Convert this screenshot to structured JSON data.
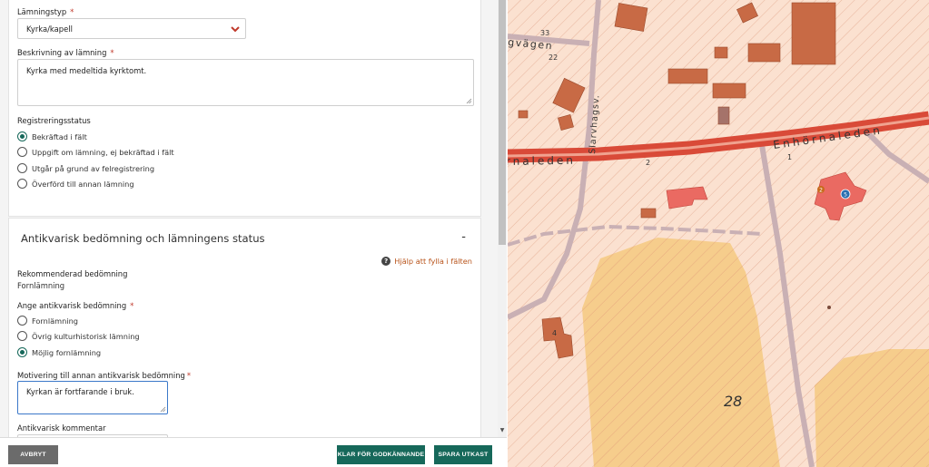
{
  "form": {
    "lamningstyp": {
      "label": "Lämningstyp",
      "required_mark": "*",
      "value": "Kyrka/kapell"
    },
    "beskrivning": {
      "label": "Beskrivning av lämning",
      "required_mark": "*",
      "value": "Kyrka med medeltida kyrktomt."
    },
    "registreringsstatus": {
      "label": "Registreringsstatus",
      "options": [
        {
          "label": "Bekräftad i fält",
          "selected": true
        },
        {
          "label": "Uppgift om lämning, ej bekräftad i fält",
          "selected": false
        },
        {
          "label": "Utgår på grund av felregistrering",
          "selected": false
        },
        {
          "label": "Överförd till annan lämning",
          "selected": false
        }
      ]
    },
    "antikvarisk": {
      "title": "Antikvarisk bedömning och lämningens status",
      "collapse_symbol": "-",
      "help_link": "Hjälp att fylla i fälten",
      "rekommenderad_label": "Rekommenderad bedömning",
      "rekommenderad_value": "Fornlämning",
      "ange_label": "Ange antikvarisk bedömning",
      "ange_required_mark": "*",
      "options": [
        {
          "label": "Fornlämning",
          "selected": false
        },
        {
          "label": "Övrig kulturhistorisk lämning",
          "selected": false
        },
        {
          "label": "Möjlig fornlämning",
          "selected": true
        }
      ],
      "motivering_label": "Motivering till annan antikvarisk bedömning",
      "motivering_required_mark": "*",
      "motivering_value": "Kyrkan är fortfarande i bruk.",
      "kommentar_label": "Antikvarisk kommentar"
    }
  },
  "buttons": {
    "cancel": "AVBRYT",
    "ready": "KLAR FÖR GODKÄNNANDE",
    "save": "SPARA UTKAST"
  },
  "map": {
    "labels": {
      "road_main_right": "Enhörnaleden",
      "road_main_left": "rnaleden",
      "road_vertical": "Slarvhagsv.",
      "road_top_left": "gvägen",
      "num_33": "33",
      "num_22": "22",
      "num_2": "2",
      "num_1": "1",
      "num_4": "4",
      "num_28": "28",
      "marker_1": "1",
      "marker_2": "2",
      "marker_5": "5"
    }
  },
  "colors": {
    "accent": "#16685a",
    "link": "#b8531a",
    "required": "#c0392b",
    "road": "#d94a38",
    "building": "#c86a45"
  }
}
